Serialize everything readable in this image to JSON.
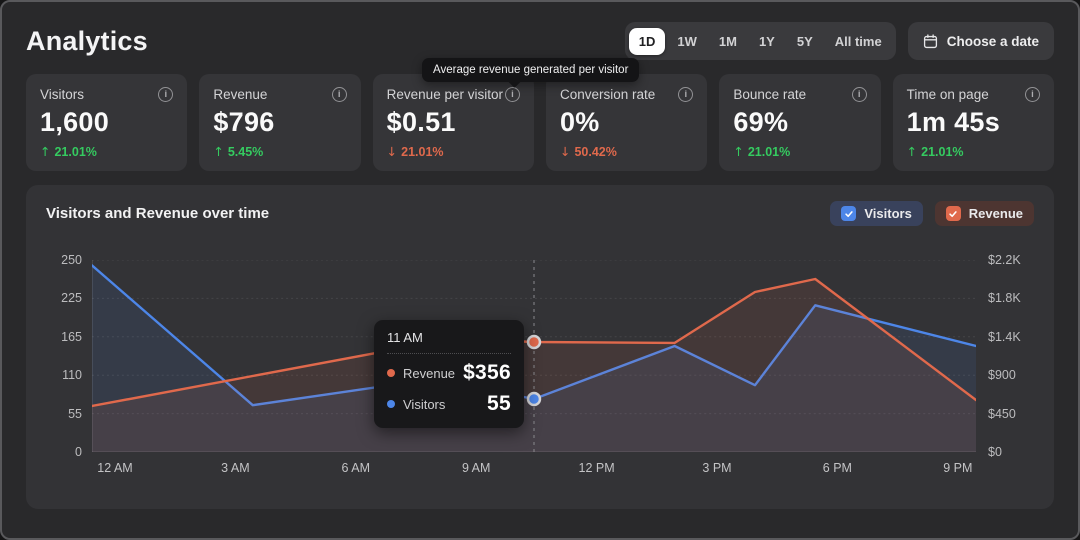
{
  "colors": {
    "blue": "#4d86e8",
    "coral": "#e0694c",
    "green": "#35cb60",
    "legend_visitors_bg": "#39425c",
    "legend_revenue_bg": "#4d3531",
    "dot_ring": "#d6d6d9"
  },
  "page": {
    "title": "Analytics"
  },
  "toolbar": {
    "ranges": [
      {
        "label": "1D",
        "active": true
      },
      {
        "label": "1W",
        "active": false
      },
      {
        "label": "1M",
        "active": false
      },
      {
        "label": "1Y",
        "active": false
      },
      {
        "label": "5Y",
        "active": false
      },
      {
        "label": "All time",
        "active": false
      }
    ],
    "date_button_label": "Choose a date"
  },
  "stats": [
    {
      "label": "Visitors",
      "value": "1,600",
      "change": "21.01%",
      "direction": "up"
    },
    {
      "label": "Revenue",
      "value": "$796",
      "change": "5.45%",
      "direction": "up"
    },
    {
      "label": "Revenue per visitor",
      "value": "$0.51",
      "change": "21.01%",
      "direction": "down"
    },
    {
      "label": "Conversion rate",
      "value": "0%",
      "change": "50.42%",
      "direction": "down"
    },
    {
      "label": "Bounce rate",
      "value": "69%",
      "change": "21.01%",
      "direction": "up"
    },
    {
      "label": "Time on page",
      "value": "1m 45s",
      "change": "21.01%",
      "direction": "up"
    }
  ],
  "stats_tooltip": {
    "text": "Average revenue generated per visitor",
    "attached_to": "Revenue per visitor"
  },
  "chart": {
    "title": "Visitors and Revenue over time",
    "legend": [
      {
        "label": "Visitors",
        "checkbox": "#4d86e8",
        "pill": "#39425c",
        "checked": true
      },
      {
        "label": "Revenue",
        "checkbox": "#e0694c",
        "pill": "#4d3531",
        "checked": true
      }
    ],
    "tooltip": {
      "time": "11 AM",
      "rows": [
        {
          "label": "Revenue",
          "value": "$356",
          "color": "#e0694c"
        },
        {
          "label": "Visitors",
          "value": "55",
          "color": "#4d86e8"
        }
      ]
    }
  },
  "chart_data": {
    "type": "line",
    "title": "Visitors and Revenue over time",
    "x_tick_labels": [
      "12 AM",
      "3 AM",
      "6 AM",
      "9 AM",
      "12 PM",
      "3 PM",
      "6 PM",
      "9 PM"
    ],
    "x_domain_hours": [
      0,
      22
    ],
    "left_axis": {
      "label": "Visitors",
      "tick_labels": [
        "0",
        "55",
        "110",
        "165",
        "225",
        "250"
      ],
      "max": 250
    },
    "right_axis": {
      "label": "Revenue",
      "tick_labels": [
        "$0",
        "$450",
        "$900",
        "$1.4K",
        "$1.8K",
        "$2.2K"
      ],
      "max": 2200
    },
    "grid": true,
    "legend_position": "top-right",
    "series": [
      {
        "name": "Visitors",
        "axis": "left",
        "color": "#4d86e8",
        "points": [
          [
            0,
            243
          ],
          [
            4,
            61
          ],
          [
            8.5,
            95
          ],
          [
            11,
            69
          ],
          [
            14.5,
            138
          ],
          [
            16.5,
            87
          ],
          [
            18,
            191
          ],
          [
            22,
            138
          ]
        ]
      },
      {
        "name": "Revenue",
        "axis": "right",
        "color": "#e0694c",
        "points": [
          [
            0,
            527
          ],
          [
            9,
            1300
          ],
          [
            11,
            1260
          ],
          [
            14.5,
            1250
          ],
          [
            16.5,
            1833
          ],
          [
            18,
            1982
          ],
          [
            22,
            596
          ]
        ]
      }
    ],
    "hover": {
      "hour": 11,
      "label": "11 AM",
      "values": {
        "Revenue": 356,
        "Visitors": 55
      }
    }
  }
}
